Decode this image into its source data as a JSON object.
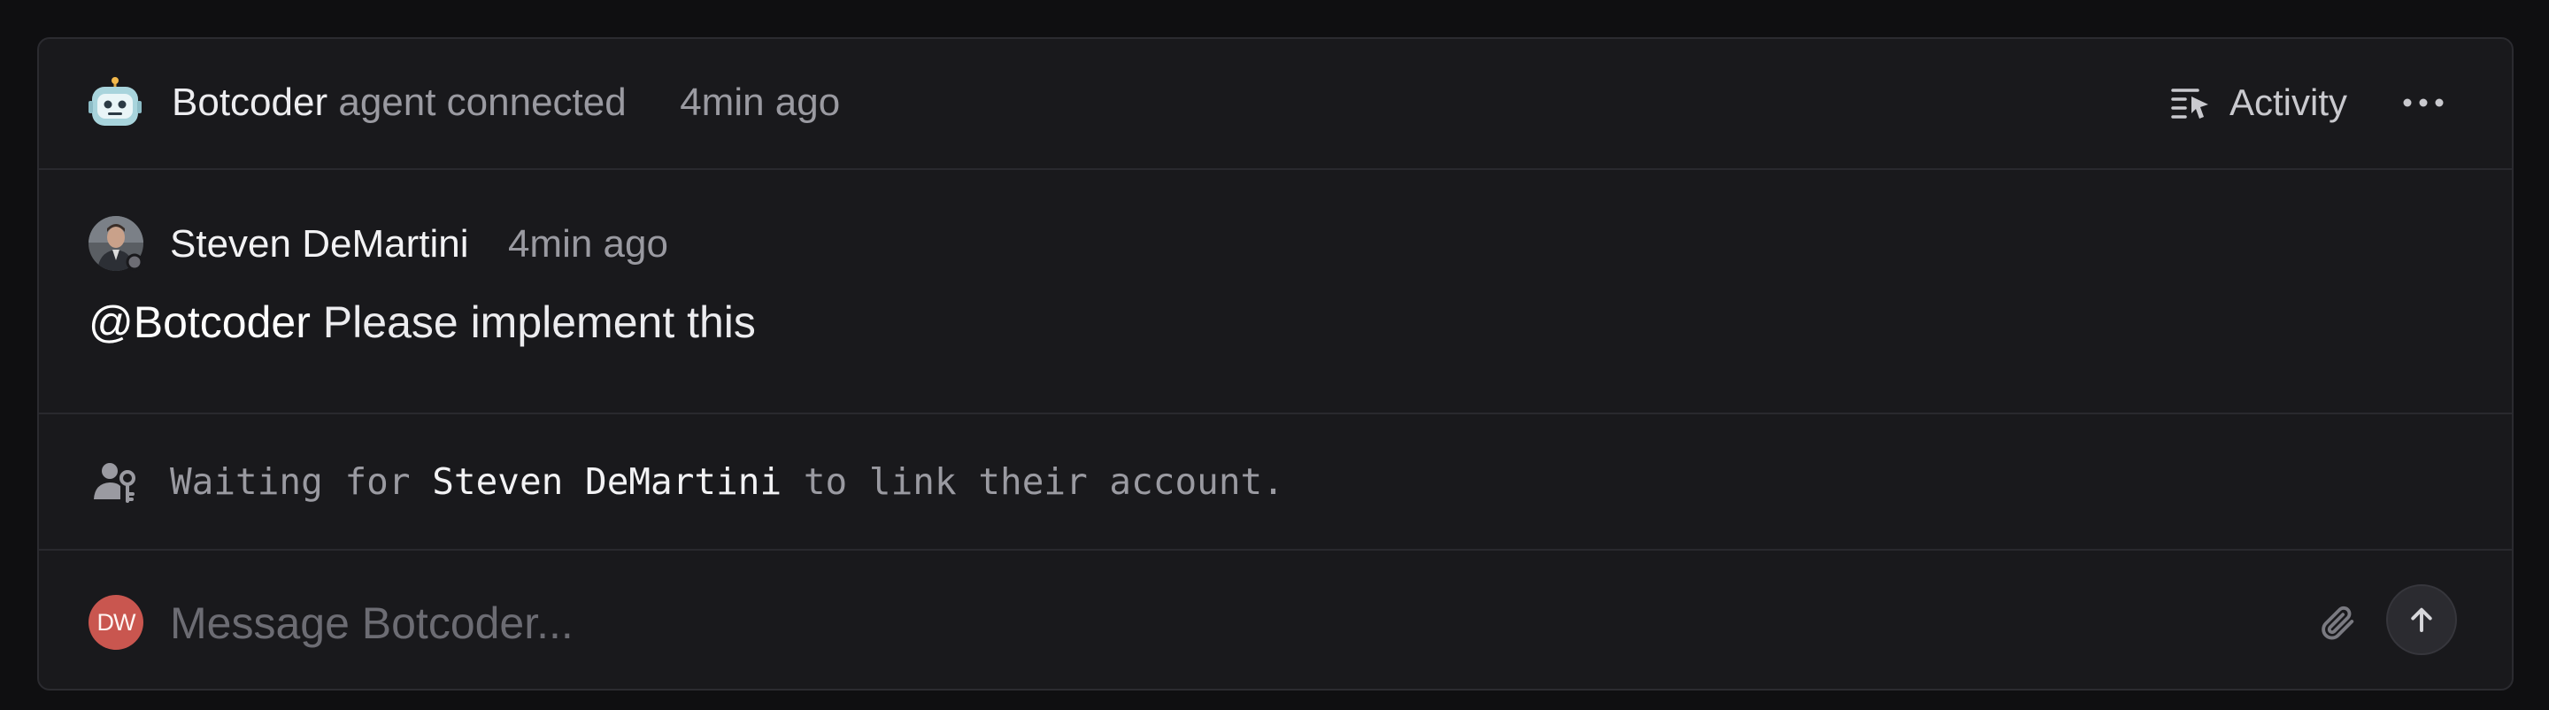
{
  "header": {
    "bot_name": "Botcoder",
    "status_text": "agent connected",
    "time": "4min ago",
    "activity_label": "Activity",
    "bot_avatar_icon": "robot-icon",
    "activity_icon": "activity-list-icon",
    "more_icon": "more-horizontal-icon"
  },
  "comment": {
    "author": "Steven DeMartini",
    "time": "4min ago",
    "mention": "@Botcoder",
    "text": "Please implement this"
  },
  "waiting": {
    "prefix": "Waiting for",
    "name": "Steven DeMartini",
    "suffix": "to link their account.",
    "icon": "user-key-icon"
  },
  "composer": {
    "avatar_initials": "DW",
    "avatar_color": "#c9564f",
    "placeholder": "Message Botcoder...",
    "value": "",
    "attach_icon": "paperclip-icon",
    "send_icon": "arrow-up-icon"
  },
  "colors": {
    "background": "#0f0f11",
    "card": "#19191c",
    "border": "#2b2b30",
    "muted_text": "#9a9aa1"
  }
}
